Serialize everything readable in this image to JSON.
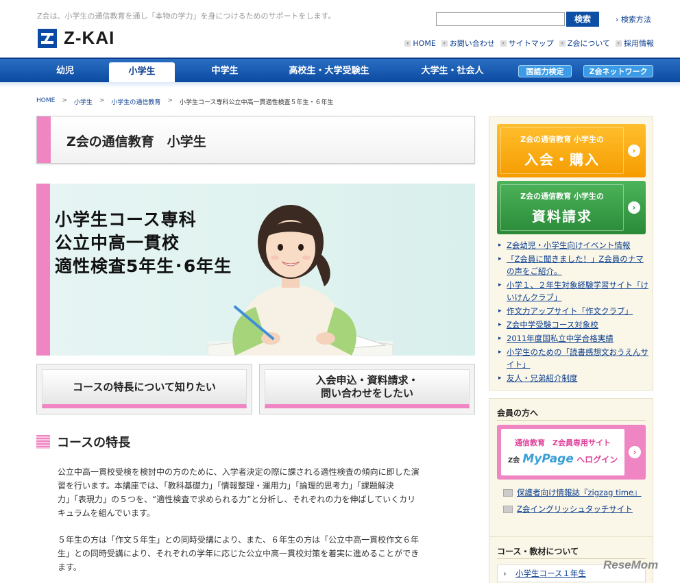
{
  "header": {
    "tagline": "Z会は、小学生の通信教育を通し「本物の学力」を身につけるためのサポートをします。",
    "logo_text": "Z-KAI",
    "search_placeholder": "",
    "search_button": "検索",
    "search_help": "検索方法",
    "util_nav": [
      "HOME",
      "お問い合わせ",
      "サイトマップ",
      "Z会について",
      "採用情報"
    ]
  },
  "gnav": {
    "tabs": [
      "幼児",
      "小学生",
      "中学生",
      "高校生・大学受験生",
      "大学生・社会人"
    ],
    "active_tab": "小学生",
    "pills": [
      "国語力検定",
      "Z会ネットワーク"
    ]
  },
  "breadcrumb": [
    "HOME",
    "小学生",
    "小学生の通信教育",
    "小学生コース専科公立中高一貫適性検査５年生・６年生"
  ],
  "breadcrumb_sep": ">",
  "page_title": "Z会の通信教育　小学生",
  "hero": {
    "lines": [
      "小学生コース専科",
      "公立中高一貫校",
      "適性検査5年生･6年生"
    ]
  },
  "cta": {
    "left": "コースの特長について知りたい",
    "right_line1": "入会申込・資料請求・",
    "right_line2": "問い合わせをしたい"
  },
  "section": {
    "heading": "コースの特長",
    "para1": [
      "公立中高一貫校受検を検討中の方のために、入学者決定の際に課される適性検査の傾向に即した演",
      "習を行います。本講座では、「教科基礎力」「情報整理・運用力」「論理的思考力」「課題解決",
      "力」「表現力」の５つを、“適性検査で求められる力”と分析し、それぞれの力を伸ばしていくカリ",
      "キュラムを組んでいます。"
    ],
    "para2": [
      "５年生の方は「作文５年生」との同時受講により、また、６年生の方は「公立中高一貫校作文６年",
      "生」との同時受講により、それぞれの学年に応じた公立中高一貫校対策を着実に進めることができ",
      "ます。"
    ]
  },
  "sidebar": {
    "btn1_small": "Z会の通信教育 小学生の",
    "btn1_big": "入会・購入",
    "btn2_small": "Z会の通信教育 小学生の",
    "btn2_big": "資料請求",
    "arrow": "›",
    "links": [
      "Z会幼児・小学生向けイベント情報",
      "「Z会員に聞きました！」Z会員のナマの声をご紹介。",
      "小学１、２年生対象経験学習サイト「けいけんクラブ」",
      "作文力アップサイト「作文クラブ」",
      "Z会中学受験コース対象校",
      "2011年度国私立中学合格実績",
      "小学生のための「読書感想文おうえんサイト」",
      "友人・兄弟紹介制度"
    ],
    "member_head": "会員の方へ",
    "mypage_line1": "通信教育　Z会員専用サイト",
    "mypage_zkai": "Z会",
    "mypage_logo": "MyPage",
    "mypage_login": "へログイン",
    "member_links": [
      "保護者向け情報誌『zigzag time』",
      "Z会イングリッシュタッチサイト"
    ],
    "course_head": "コース・教材について",
    "course_item": "小学生コース１年生"
  },
  "watermark": "ReseMom",
  "colors": {
    "brand_blue": "#0b4aa0",
    "accent_pink": "#ef86c3",
    "orange": "#f5a100",
    "green": "#2f9a3e"
  }
}
